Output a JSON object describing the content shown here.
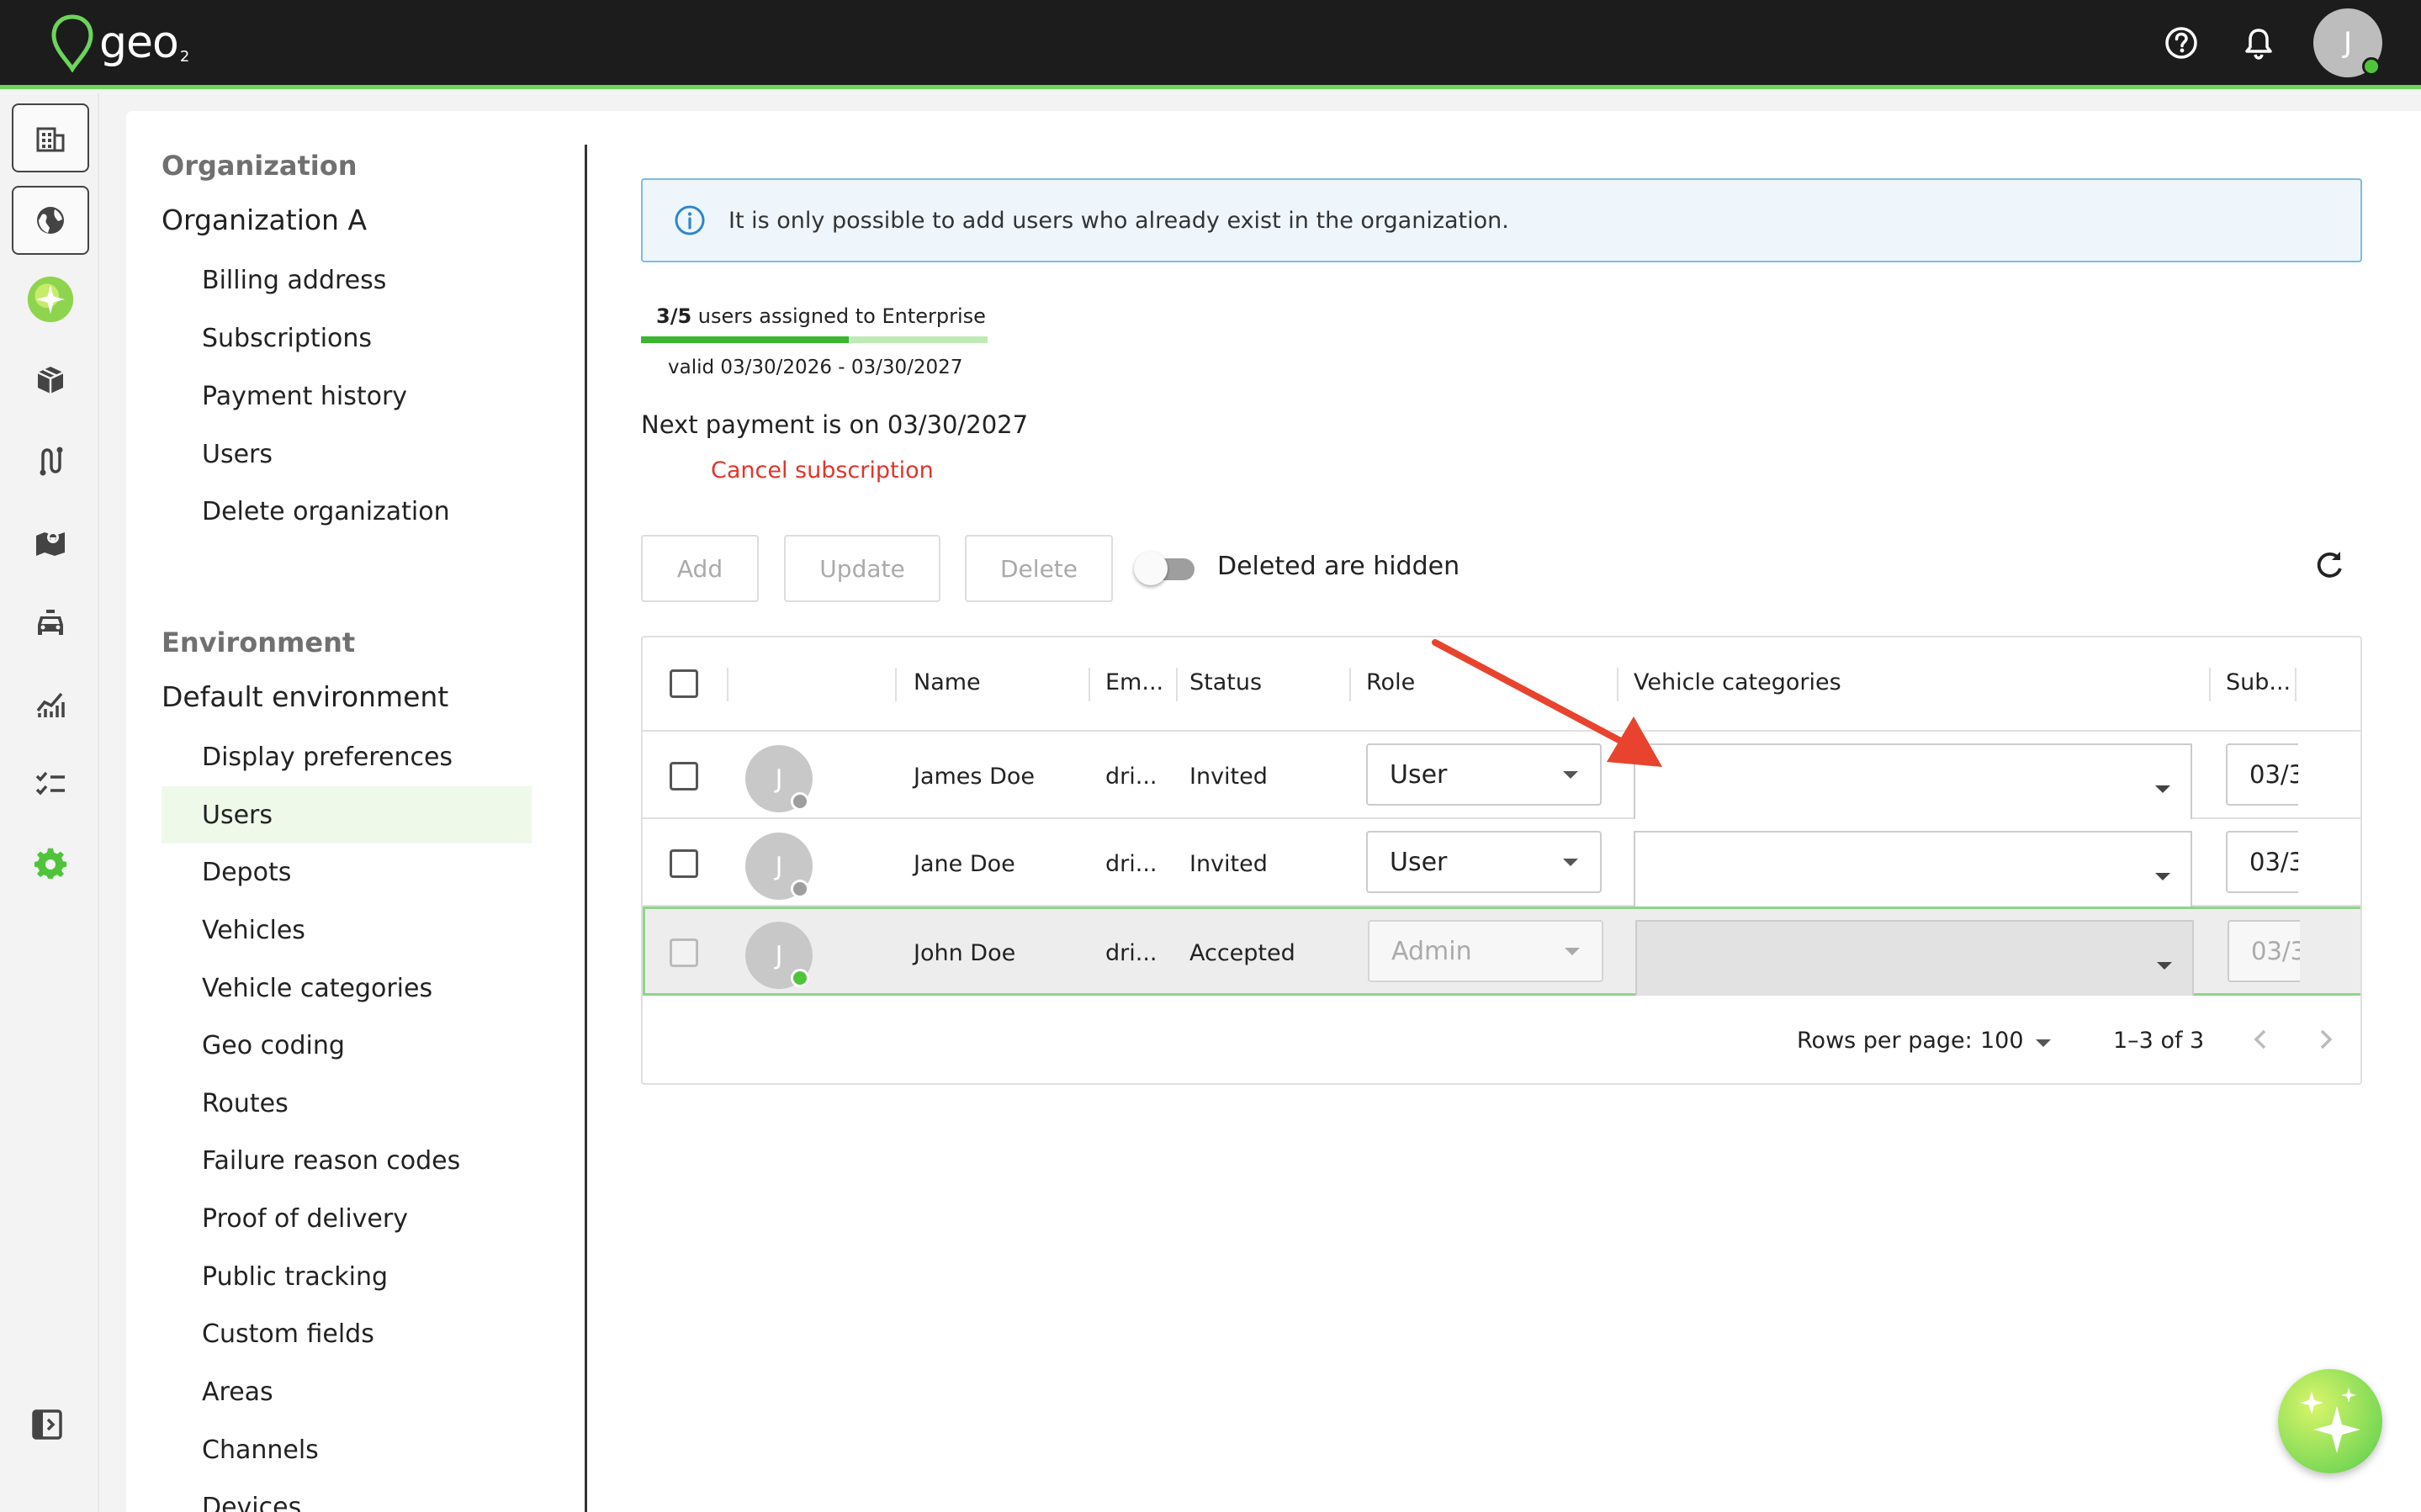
{
  "app": {
    "logo_text": "geo",
    "logo_sub": "2",
    "avatar_initial": "J"
  },
  "icons": {
    "help": "help-circle-icon",
    "notifications": "bell-icon",
    "info": "info-icon",
    "refresh": "refresh-icon"
  },
  "sidebar": {
    "organization_heading": "Organization",
    "organization_name": "Organization A",
    "organization_items": [
      "Billing address",
      "Subscriptions",
      "Payment history",
      "Users",
      "Delete organization"
    ],
    "environment_heading": "Environment",
    "environment_name": "Default environment",
    "environment_items": [
      "Display preferences",
      "Users",
      "Depots",
      "Vehicles",
      "Vehicle categories",
      "Geo coding",
      "Routes",
      "Failure reason codes",
      "Proof of delivery",
      "Public tracking",
      "Custom fields",
      "Areas",
      "Channels",
      "Devices"
    ],
    "active_item": "Users"
  },
  "main": {
    "info_text": "It is only possible to add users who already exist in the organization.",
    "subscription": {
      "count": "3/5",
      "text": " users assigned to Enterprise",
      "progress_fraction": 0.6,
      "validity": "valid 03/30/2026 - 03/30/2027"
    },
    "next_payment": "Next payment is on 03/30/2027",
    "cancel_label": "Cancel subscription",
    "toolbar": {
      "add_label": "Add",
      "update_label": "Update",
      "delete_label": "Delete",
      "toggle_label": "Deleted are hidden"
    },
    "table": {
      "headers": {
        "name": "Name",
        "email": "Em...",
        "status": "Status",
        "role": "Role",
        "vehicle_categories": "Vehicle categories",
        "sub": "Sub..."
      },
      "rows": [
        {
          "initial": "J",
          "name": "James Doe",
          "email": "dri...",
          "status": "Invited",
          "role": "User",
          "date": "03/3",
          "online": false
        },
        {
          "initial": "J",
          "name": "Jane Doe",
          "email": "dri...",
          "status": "Invited",
          "role": "User",
          "date": "03/3",
          "online": false
        },
        {
          "initial": "J",
          "name": "John Doe",
          "email": "dri...",
          "status": "Accepted",
          "role": "Admin",
          "date": "03/3",
          "online": true
        }
      ],
      "footer": {
        "rows_per_page_label": "Rows per page:",
        "rows_per_page_value": "100",
        "range": "1–3 of 3"
      }
    }
  },
  "colors": {
    "brand_green": "#6cd45a",
    "danger_red": "#e0352b",
    "info_blue": "#2f86c9",
    "annotation_arrow": "#e8432e"
  }
}
